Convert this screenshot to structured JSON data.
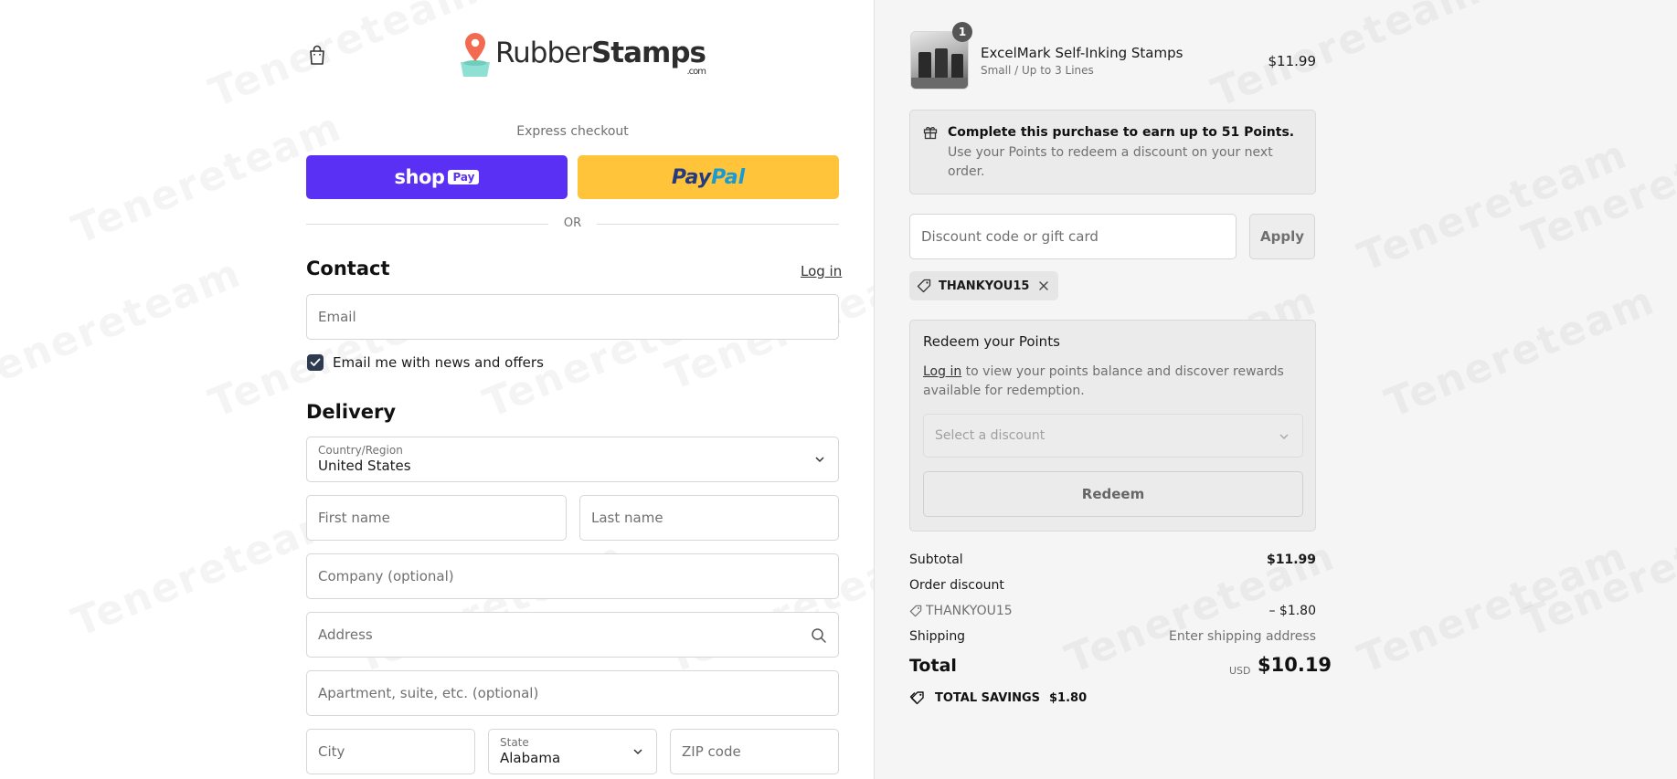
{
  "brand": {
    "name_regular": "Rubber",
    "name_bold": "Stamps",
    "suffix": ".com",
    "watermark": "Tenereteam"
  },
  "express": {
    "label": "Express checkout",
    "shop_word": "shop",
    "shop_badge": "Pay",
    "paypal_part1": "Pay",
    "paypal_part2": "Pal",
    "divider": "OR"
  },
  "contact": {
    "heading": "Contact",
    "login_link": "Log in",
    "email_placeholder": "Email",
    "newsletter_label": "Email me with news and offers",
    "newsletter_checked": true
  },
  "delivery": {
    "heading": "Delivery",
    "country_label": "Country/Region",
    "country_value": "United States",
    "first_name_placeholder": "First name",
    "last_name_placeholder": "Last name",
    "company_placeholder": "Company (optional)",
    "address_placeholder": "Address",
    "apartment_placeholder": "Apartment, suite, etc. (optional)",
    "city_placeholder": "City",
    "state_label": "State",
    "state_value": "Alabama",
    "zip_placeholder": "ZIP code"
  },
  "cart": {
    "item": {
      "quantity": "1",
      "name": "ExcelMark Self-Inking Stamps",
      "variant": "Small / Up to 3 Lines",
      "price": "$11.99"
    }
  },
  "points": {
    "earn_title": "Complete this purchase to earn up to 51 Points.",
    "earn_desc": "Use your Points to redeem a discount on your next order."
  },
  "discount": {
    "placeholder": "Discount code or gift card",
    "apply_label": "Apply",
    "applied_code": "THANKYOU15"
  },
  "redeem": {
    "title": "Redeem your Points",
    "login_link": "Log in",
    "desc_rest": " to view your points balance and discover rewards available for redemption.",
    "select_placeholder": "Select a discount",
    "button_label": "Redeem"
  },
  "summary": {
    "subtotal_label": "Subtotal",
    "subtotal_value": "$11.99",
    "order_discount_label": "Order discount",
    "discount_code": "THANKYOU15",
    "discount_value": "– $1.80",
    "shipping_label": "Shipping",
    "shipping_value": "Enter shipping address",
    "total_label": "Total",
    "currency": "USD",
    "total_value": "$10.19",
    "savings_label": "TOTAL SAVINGS",
    "savings_value": "$1.80"
  },
  "colors": {
    "shop_pay": "#5a31f4",
    "paypal_yellow": "#ffc439",
    "paypal_dark": "#253b80",
    "paypal_light": "#179bd7",
    "checkbox": "#2e3a4f",
    "panel_bg": "#f5f5f5"
  },
  "icons": {
    "cart": "shopping-bag-icon",
    "logo": "map-pin-icon",
    "gift": "gift-icon",
    "tag": "tag-icon",
    "remove": "close-icon",
    "search": "search-icon",
    "select": "chevron-down-icon",
    "savings": "tags-icon",
    "check": "checkmark-icon"
  }
}
